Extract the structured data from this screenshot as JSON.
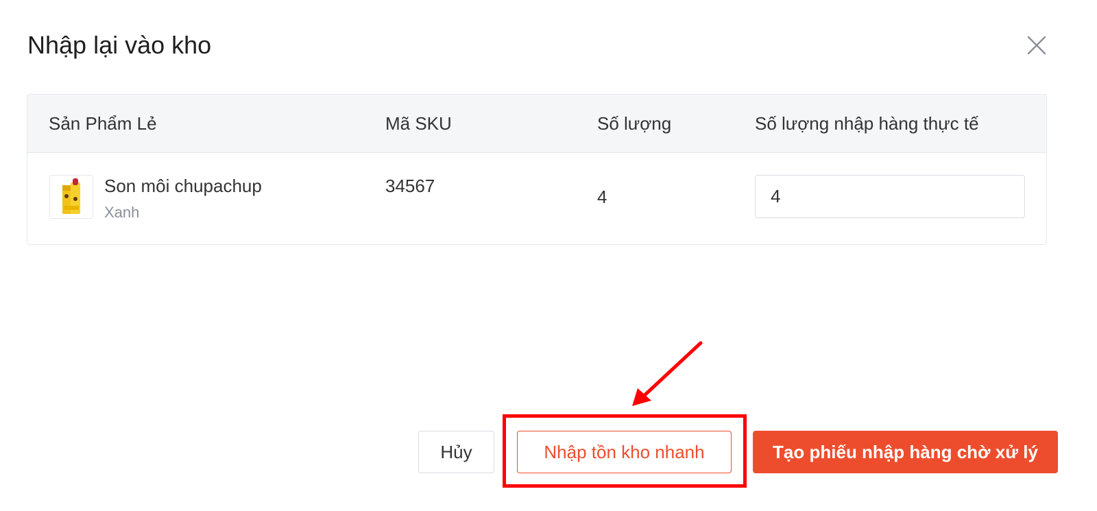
{
  "dialog": {
    "title": "Nhập lại vào kho",
    "close_icon": "close-icon"
  },
  "table": {
    "headers": [
      "Sản Phẩm Lẻ",
      "Mã SKU",
      "Số lượng",
      "Số lượng nhập hàng thực tế"
    ],
    "rows": [
      {
        "thumbnail_icon": "product-thumbnail",
        "name": "Son môi chupachup",
        "variant": "Xanh",
        "sku": "34567",
        "quantity": "4",
        "actual_quantity": "4"
      }
    ]
  },
  "footer": {
    "cancel_label": "Hủy",
    "quick_import_label": "Nhập tồn kho nhanh",
    "create_label": "Tạo phiếu nhập hàng chờ xử lý"
  },
  "colors": {
    "accent": "#ee4d2d",
    "annotation": "#ff0000",
    "header_bg": "#f5f6f8"
  }
}
